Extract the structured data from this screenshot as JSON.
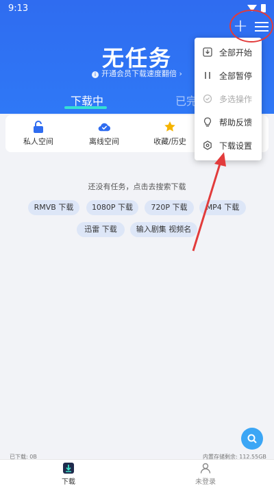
{
  "status": {
    "time": "9:13"
  },
  "header": {
    "title": "无任务",
    "subtitle": "开通会员下载速度翻倍 ›",
    "add_label": "+",
    "info_symbol": "i"
  },
  "tabs": [
    {
      "label": "下载中",
      "active": true
    },
    {
      "label": "已完成",
      "active": false
    }
  ],
  "quick_actions": [
    {
      "label": "私人空间",
      "icon": "lock-icon",
      "color": "#2f6cf0"
    },
    {
      "label": "离线空间",
      "icon": "cloud-check-icon",
      "color": "#2f6cf0"
    },
    {
      "label": "收藏/历史",
      "icon": "star-icon",
      "color": "#f5b400"
    }
  ],
  "empty": {
    "message": "还没有任务，点击去搜索下载",
    "chips": [
      "RMVB 下载",
      "1080P 下载",
      "720P 下载",
      "MP4 下载",
      "迅雷 下载",
      "输入剧集 视频名"
    ]
  },
  "menu": {
    "items": [
      {
        "label": "全部开始",
        "icon": "download-box-icon",
        "enabled": true
      },
      {
        "label": "全部暂停",
        "icon": "pause-icon",
        "enabled": true
      },
      {
        "label": "多选操作",
        "icon": "check-circle-icon",
        "enabled": false
      },
      {
        "label": "帮助反馈",
        "icon": "lightbulb-icon",
        "enabled": true
      },
      {
        "label": "下载设置",
        "icon": "settings-hex-icon",
        "enabled": true
      }
    ]
  },
  "storage": {
    "downloaded": "已下载: 0B",
    "remaining": "内置存储剩余: 112.55GB"
  },
  "bottom_nav": [
    {
      "label": "下载",
      "icon": "download-tab-icon",
      "active": true
    },
    {
      "label": "未登录",
      "icon": "user-icon",
      "active": false
    }
  ],
  "colors": {
    "primary": "#2f6cf0",
    "accent_underline": "#35e0d4",
    "annotation_red": "#e23b3b",
    "fab": "#3ca6f5"
  }
}
